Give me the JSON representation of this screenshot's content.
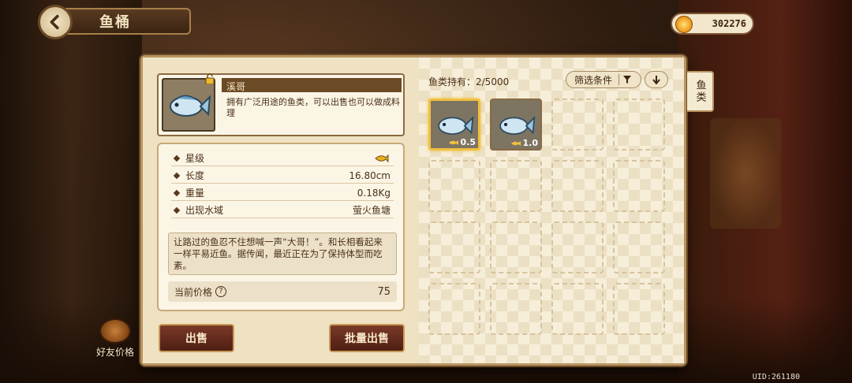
{
  "header": {
    "title": "鱼桶"
  },
  "currency": {
    "coins": "302276"
  },
  "detail": {
    "fish_name": "溪哥",
    "short_desc": "拥有广泛用途的鱼类，可以出售也可以做成料理",
    "stats": [
      {
        "label": "星级",
        "value": ""
      },
      {
        "label": "长度",
        "value": "16.80cm"
      },
      {
        "label": "重量",
        "value": "0.18Kg"
      },
      {
        "label": "出现水域",
        "value": "萤火鱼塘"
      }
    ],
    "lore": "让路过的鱼忍不住想喊一声“大哥！”。和长相看起来一样平易近鱼。据传闻，最近正在为了保持体型而吃素。",
    "price_label": "当前价格",
    "price_help": "?",
    "price_value": "75"
  },
  "buttons": {
    "sell": "出售",
    "bulk_sell": "批量出售"
  },
  "inventory": {
    "holding_label": "鱼类持有：2/5000",
    "filter_label": "筛选条件",
    "slots": [
      {
        "size": "0.5",
        "selected": true
      },
      {
        "size": "1.0",
        "selected": false
      }
    ]
  },
  "side_tab": "鱼类",
  "friend_price": "好友价格",
  "uid": "UID:261180",
  "colors": {
    "panel": "#f4ead2",
    "accent_brown": "#6b4a26",
    "button": "#5e2818",
    "selected": "#f0c040"
  },
  "icons": [
    "back-arrow-icon",
    "coin-icon",
    "lock-icon",
    "fish-icon",
    "filter-icon",
    "sort-down-icon",
    "help-icon",
    "fish-size-icon",
    "barrel-icon"
  ]
}
